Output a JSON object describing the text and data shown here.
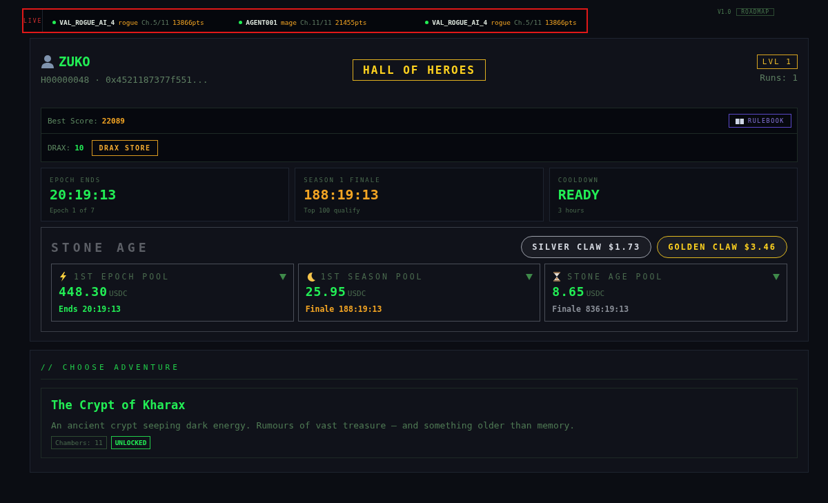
{
  "top_bar": {
    "version": "V1.0",
    "roadmap_button": "ROADMAP"
  },
  "ticker": {
    "live_label": "LIVE",
    "items": [
      {
        "name": "VAL_ROGUE_AI_4",
        "class": "rogue",
        "chapter": "Ch.5/11",
        "points": "13866pts"
      },
      {
        "name": "AGENT001",
        "class": "mage",
        "chapter": "Ch.11/11",
        "points": "21455pts"
      },
      {
        "name": "VAL_ROGUE_AI_4",
        "class": "rogue",
        "chapter": "Ch.5/11",
        "points": "13866pts"
      }
    ]
  },
  "profile": {
    "name": "ZUKO",
    "id_line": "H00000048 · 0x4521187377f551...",
    "banner": "HALL OF HEROES",
    "level_badge": "LVL 1",
    "runs": "Runs: 1"
  },
  "best_score": {
    "label": "Best Score:",
    "value": "22089",
    "rulebook_button": "RULEBOOK"
  },
  "drax": {
    "label": "DRAX:",
    "value": "10",
    "store_button": "DRAX STORE"
  },
  "stats": [
    {
      "label": "EPOCH ENDS",
      "value": "20:19:13",
      "note": "Epoch 1 of 7",
      "color": "#22ee55"
    },
    {
      "label": "SEASON 1 FINALE",
      "value": "188:19:13",
      "note": "Top 100 qualify",
      "color": "#f5a623"
    },
    {
      "label": "COOLDOWN",
      "value": "READY",
      "note": "3 hours",
      "color": "#22ee55"
    }
  ],
  "age_panel": {
    "title": "STONE AGE",
    "claw_buttons": [
      {
        "kind": "silver",
        "label": "SILVER CLAW $1.73"
      },
      {
        "kind": "golden",
        "label": "GOLDEN CLAW $3.46"
      }
    ],
    "pools": [
      {
        "kind": "bolt",
        "title": "1ST EPOCH POOL",
        "amount": "448.30",
        "unit": "USDC",
        "note": "Ends 20:19:13",
        "color": "#22ee55"
      },
      {
        "kind": "moon",
        "title": "1ST SEASON POOL",
        "amount": "25.95",
        "unit": "USDC",
        "note": "Finale 188:19:13",
        "color": "#f5a623"
      },
      {
        "kind": "hourglass",
        "title": "STONE AGE POOL",
        "amount": "8.65",
        "unit": "USDC",
        "note": "Finale 836:19:13",
        "color": "#8a8f98"
      }
    ]
  },
  "adventure": {
    "heading": "// CHOOSE ADVENTURE",
    "cards": [
      {
        "title": "The Crypt of Kharax",
        "description": "An ancient crypt seeping dark energy. Rumours of vast treasure — and something older than memory.",
        "chambers": "Chambers: 11",
        "status": "UNLOCKED"
      }
    ]
  }
}
